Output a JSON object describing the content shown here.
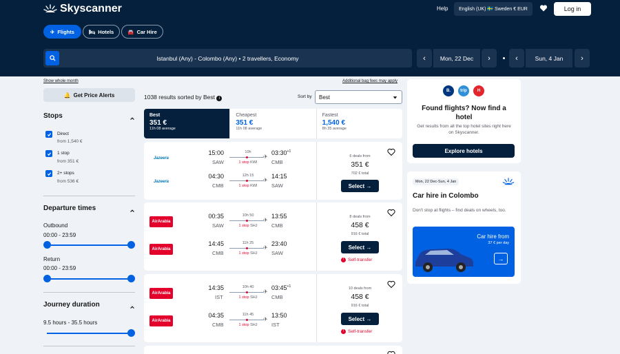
{
  "brand": {
    "name": "Skyscanner",
    "accent": "#0062e3",
    "navy": "#05203c"
  },
  "header": {
    "help": "Help",
    "locale": "English (UK) 🇸🇪 Sweden  € EUR",
    "login": "Log in"
  },
  "nav_chips": [
    {
      "label": "Flights",
      "icon": "plane-icon"
    },
    {
      "label": "Hotels",
      "icon": "bed-icon"
    },
    {
      "label": "Car Hire",
      "icon": "car-icon"
    }
  ],
  "search": {
    "summary": "Istanbul (Any) - Colombo (Any)  •  2 travellers, Economy",
    "depart": "Mon, 22 Dec",
    "return": "Sun, 4 Jan"
  },
  "sidebar": {
    "show_month": "Show whole month",
    "alert": "Get Price Alerts",
    "stops_title": "Stops",
    "stops": [
      {
        "label": "Direct",
        "sub": "from 1,540 €"
      },
      {
        "label": "1 stop",
        "sub": "from 351 €"
      },
      {
        "label": "2+ stops",
        "sub": "from 536 €"
      }
    ],
    "departure_title": "Departure times",
    "outbound_label": "Outbound",
    "outbound_range": "00:00 - 23:59",
    "return_label": "Return",
    "return_range": "00:00 - 23:59",
    "duration_title": "Journey duration",
    "duration_range": "9.5 hours - 35.5 hours"
  },
  "results": {
    "count": "1038 results sorted by Best",
    "bag_fees": "Additional bag fees may apply",
    "sort_label": "Sort by",
    "sort_value": "Best",
    "tabs": [
      {
        "name": "Best",
        "price": "351 €",
        "avg": "11h 08 average"
      },
      {
        "name": "Cheapest",
        "price": "351 €",
        "avg": "11h 08 average"
      },
      {
        "name": "Fastest",
        "price": "1,540 €",
        "avg": "8h 35 average"
      }
    ],
    "select_label": "Select →",
    "self_transfer": "Self-transfer",
    "cards": [
      {
        "legs": [
          {
            "airline": "Jazeera",
            "dep": "15:00",
            "from": "SAW",
            "dur": "10h",
            "stop": "1 stop",
            "via": "KWI",
            "arr": "03:30",
            "plus": "+1",
            "to": "CMB"
          },
          {
            "airline": "Jazeera",
            "dep": "04:30",
            "from": "CMB",
            "dur": "12h 15",
            "stop": "1 stop",
            "via": "KWI",
            "arr": "14:15",
            "plus": "",
            "to": "SAW"
          }
        ],
        "deals": "6 deals from",
        "price": "351 €",
        "total": "702 € total"
      },
      {
        "legs": [
          {
            "airline": "AirArabia",
            "dep": "00:35",
            "from": "SAW",
            "dur": "10h 50",
            "stop": "1 stop",
            "via": "SHJ",
            "arr": "13:55",
            "plus": "",
            "to": "CMB"
          },
          {
            "airline": "AirArabia",
            "dep": "14:45",
            "from": "CMB",
            "dur": "11h 25",
            "stop": "1 stop",
            "via": "SHJ",
            "arr": "23:40",
            "plus": "",
            "to": "SAW"
          }
        ],
        "deals": "8 deals from",
        "price": "458 €",
        "total": "916 € total"
      },
      {
        "legs": [
          {
            "airline": "AirArabia",
            "dep": "14:35",
            "from": "IST",
            "dur": "10h 40",
            "stop": "1 stop",
            "via": "SHJ",
            "arr": "03:45",
            "plus": "+1",
            "to": "CMB"
          },
          {
            "airline": "AirArabia",
            "dep": "04:35",
            "from": "CMB",
            "dur": "11h 45",
            "stop": "1 stop",
            "via": "SHJ",
            "arr": "13:50",
            "plus": "",
            "to": "IST"
          }
        ],
        "deals": "10 deals from",
        "price": "458 €",
        "total": "916 € total"
      }
    ]
  },
  "right": {
    "hotels_title": "Found flights? Now find a hotel",
    "hotels_text": "Get results from all the top hotel sites right here on Skyscanner.",
    "hotels_btn": "Explore hotels",
    "car_dates": "Mon, 22 Dec-Sun, 4 Jan",
    "car_title": "Car hire in Colombo",
    "car_text": "Don't stop at flights – find deals on wheels, too.",
    "car_from": "Car hire from",
    "car_price": "37 € per day"
  }
}
